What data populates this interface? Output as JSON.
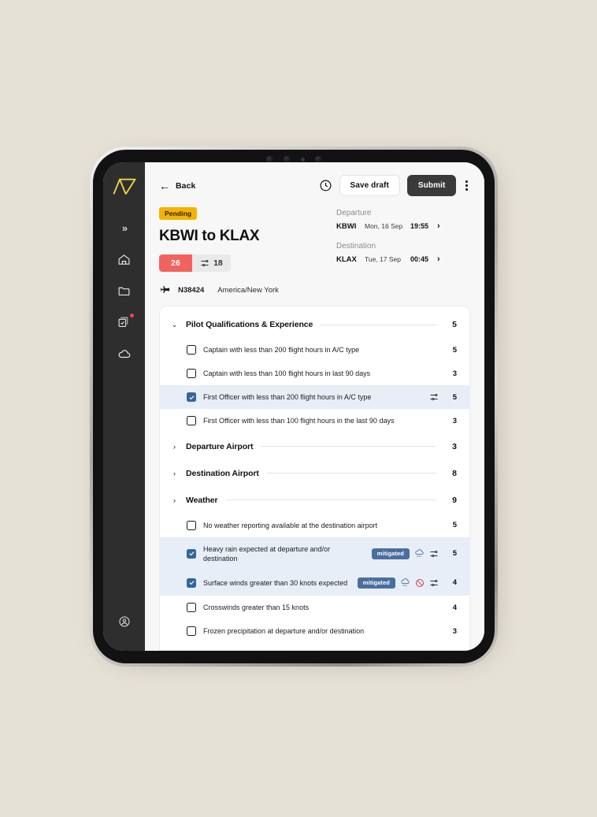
{
  "sidebar": {
    "logo_name": "logo-mark",
    "items": [
      {
        "id": "expand",
        "icon": "chevron-double-right-icon",
        "label": "Expand"
      },
      {
        "id": "home",
        "icon": "home-icon",
        "label": "Home"
      },
      {
        "id": "folder",
        "icon": "folder-icon",
        "label": "Folders"
      },
      {
        "id": "checklists",
        "icon": "checklist-icon",
        "label": "Checklists",
        "badge": true
      },
      {
        "id": "cloud",
        "icon": "cloud-icon",
        "label": "Weather"
      }
    ],
    "profile": {
      "icon": "user-circle-icon",
      "label": "Profile"
    }
  },
  "topbar": {
    "back_label": "Back",
    "history_icon": "clock-icon",
    "save_draft_label": "Save draft",
    "submit_label": "Submit",
    "more_icon": "kebab-menu-icon"
  },
  "header": {
    "status_badge": "Pending",
    "title": "KBWI to KLAX",
    "risk_score": "26",
    "mitigated_score": "18",
    "mitigated_icon": "sliders-icon",
    "aircraft_icon": "airplane-icon",
    "tail_number": "N38424",
    "timezone": "America/New York",
    "departure": {
      "label": "Departure",
      "code": "KBWI",
      "date": "Mon, 16 Sep",
      "time": "19:55",
      "chevron": "›"
    },
    "destination": {
      "label": "Destination",
      "code": "KLAX",
      "date": "Tue, 17 Sep",
      "time": "00:45",
      "chevron": "›"
    }
  },
  "checklist": {
    "sections": [
      {
        "title": "Pilot Qualifications & Experience",
        "score": "5",
        "expanded": true,
        "chevron": "⌄",
        "items": [
          {
            "label": "Captain with less than 200 flight hours in A/C type",
            "score": "5",
            "checked": false,
            "highlighted": false,
            "icons": []
          },
          {
            "label": "Captain with less than 100 flight hours in last 90 days",
            "score": "3",
            "checked": false,
            "highlighted": false,
            "icons": []
          },
          {
            "label": "First Officer with less than 200 flight hours in A/C type",
            "score": "5",
            "checked": true,
            "highlighted": true,
            "icons": [
              "sliders-icon"
            ]
          },
          {
            "label": "First Officer with less than 100 flight hours in the last 90 days",
            "score": "3",
            "checked": false,
            "highlighted": false,
            "icons": []
          }
        ]
      },
      {
        "title": "Departure Airport",
        "score": "3",
        "expanded": false,
        "chevron": "›",
        "items": []
      },
      {
        "title": "Destination Airport",
        "score": "8",
        "expanded": false,
        "chevron": "›",
        "items": []
      },
      {
        "title": "Weather",
        "score": "9",
        "expanded": true,
        "chevron": "›",
        "items": [
          {
            "label": "No weather reporting available at the destination airport",
            "score": "5",
            "checked": false,
            "highlighted": false,
            "icons": []
          },
          {
            "label": "Heavy rain expected at departure and/or destination",
            "score": "5",
            "checked": true,
            "highlighted": true,
            "mitigated_label": "mitigated",
            "icons": [
              "rain-cloud-icon",
              "sliders-icon"
            ]
          },
          {
            "label": "Surface winds greater than 30 knots expected",
            "score": "4",
            "checked": true,
            "highlighted": true,
            "mitigated_label": "mitigated",
            "icons": [
              "rain-cloud-icon",
              "prohibited-icon",
              "sliders-icon"
            ]
          },
          {
            "label": "Crosswinds greater than 15 knots",
            "score": "4",
            "checked": false,
            "highlighted": false,
            "icons": []
          },
          {
            "label": "Frozen precipitation at departure and/or destination",
            "score": "3",
            "checked": false,
            "highlighted": false,
            "icons": []
          }
        ]
      }
    ]
  },
  "colors": {
    "background": "#e6e1d6",
    "sidebar": "#2e2e2e",
    "accent_yellow": "#f5b301",
    "risk_red": "#f26360",
    "checkbox_blue": "#33669e",
    "highlight_row": "#e7eef8",
    "mitigated_pill": "#4a6f9e",
    "submit_dark": "#3a3a3a"
  }
}
